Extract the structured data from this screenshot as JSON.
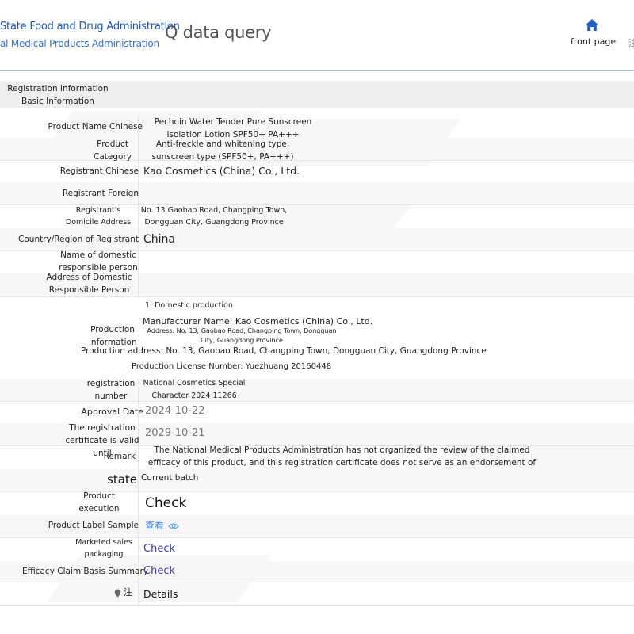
{
  "header": {
    "logo_line1": "State Food and Drug Administration",
    "logo_line2": "al Medical Products Administration",
    "title": "Q data query",
    "home_label": "front page",
    "nav_cut": "注"
  },
  "section_title": "Registration Information Basic Information",
  "rows": {
    "product_name": {
      "label": "Product Name Chinese",
      "value": "Pechoin Water Tender Pure Sunscreen Isolation Lotion SPF50+ PA+++"
    },
    "product_category": {
      "label": "Product Category",
      "value": "Anti-freckle and whitening type, sunscreen type (SPF50+, PA+++)"
    },
    "registrant_chinese": {
      "label": "Registrant Chinese",
      "value": "Kao Cosmetics (China) Co., Ltd."
    },
    "registrant_foreign": {
      "label": "Registrant Foreign",
      "value": ""
    },
    "domicile": {
      "label": "Registrant's Domicile Address",
      "value": "No. 13 Gaobao Road, Changping Town, Dongguan City, Guangdong Province"
    },
    "country": {
      "label": "Country/Region of Registrant",
      "value": "China"
    },
    "domestic_name": {
      "label": "Name of domestic responsible person",
      "value": ""
    },
    "domestic_address": {
      "label": "Address of Domestic Responsible Person",
      "value": ""
    },
    "production": {
      "label": "Production information",
      "line1": "1. Domestic production",
      "line2": "Manufacturer Name: Kao Cosmetics (China) Co., Ltd.",
      "line3": "Address: No. 13, Gaobao Road, Changping Town, Dongguan City, Guangdong Province",
      "line4": "Production address: No. 13, Gaobao Road, Changping Town, Dongguan City, Guangdong Province",
      "line5": "Production License Number: Yuezhuang 20160448"
    },
    "registration_number": {
      "label": "registration number",
      "value": "National Cosmetics Special Character 2024 11266"
    },
    "approval_date": {
      "label": "Approval Date",
      "value": "2024-10-22"
    },
    "valid_until": {
      "label": "The registration certificate is valid until",
      "value": "2029-10-21"
    },
    "remark": {
      "label": "Remark",
      "value": "The National Medical Products Administration has not organized the review of the claimed efficacy of this product, and this registration certificate does not serve as an endorsement of the product's claimed efficacy."
    },
    "state": {
      "label": "state",
      "value": "Current batch"
    },
    "execution_standard": {
      "label": "Product execution standard",
      "value": "Check"
    },
    "label_sample": {
      "label": "Product Label Sample",
      "value": "查看"
    },
    "sales_packaging": {
      "label": "Marketed sales packaging",
      "value": "Check"
    },
    "efficacy_summary": {
      "label": "Efficacy Claim Basis Summary",
      "value": "Check"
    },
    "note": {
      "label": "注",
      "value": "Details"
    }
  },
  "colors": {
    "header_line": "#a9b9d6",
    "logo_blue": "#1f56b0",
    "link": "#3a3aa8",
    "home_icon": "#1f5fc0"
  },
  "icons": {
    "home": "home-icon",
    "eye": "eye-icon",
    "pin": "pin-icon"
  }
}
